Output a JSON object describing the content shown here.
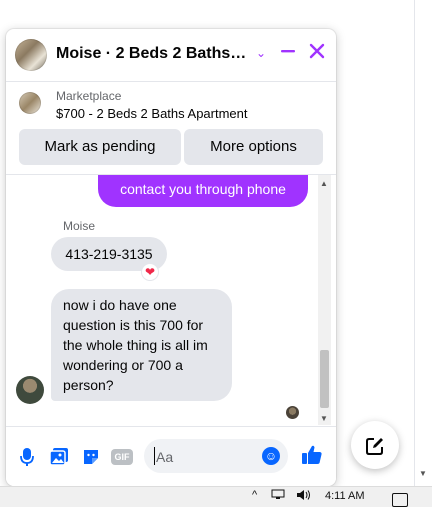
{
  "header": {
    "title": "Moise · 2 Beds 2 Baths Ap...",
    "chevron_glyph": "⌄",
    "minimize_glyph": "—",
    "close_glyph": "✕"
  },
  "listing": {
    "label": "Marketplace",
    "price_title": "$700 - 2 Beds 2 Baths Apartment",
    "mark_pending_label": "Mark as pending",
    "more_options_label": "More options"
  },
  "messages": {
    "outgoing_partial": "contact you through phone",
    "sender_name": "Moise",
    "phone_message": "413-219-3135",
    "reaction": "❤",
    "question_message": "now i do have one question is this 700 for the whole thing is all im wondering or 700 a person?"
  },
  "composer": {
    "placeholder": "Aa",
    "gif_label": "GIF",
    "icons": [
      "microphone-icon",
      "photo-icon",
      "sticker-icon",
      "gif-icon",
      "emoji-icon",
      "thumbs-up-icon"
    ]
  },
  "fab": {
    "icon": "compose-icon"
  },
  "taskbar": {
    "time": "4:11 AM",
    "icons": [
      "chevron-up-icon",
      "network-icon",
      "volume-icon",
      "notification-icon"
    ]
  },
  "colors": {
    "accent": "#a033ff",
    "messenger_blue": "#0866ff",
    "bubble_gray": "#e4e6eb",
    "button_gray": "#e4e6eb"
  }
}
